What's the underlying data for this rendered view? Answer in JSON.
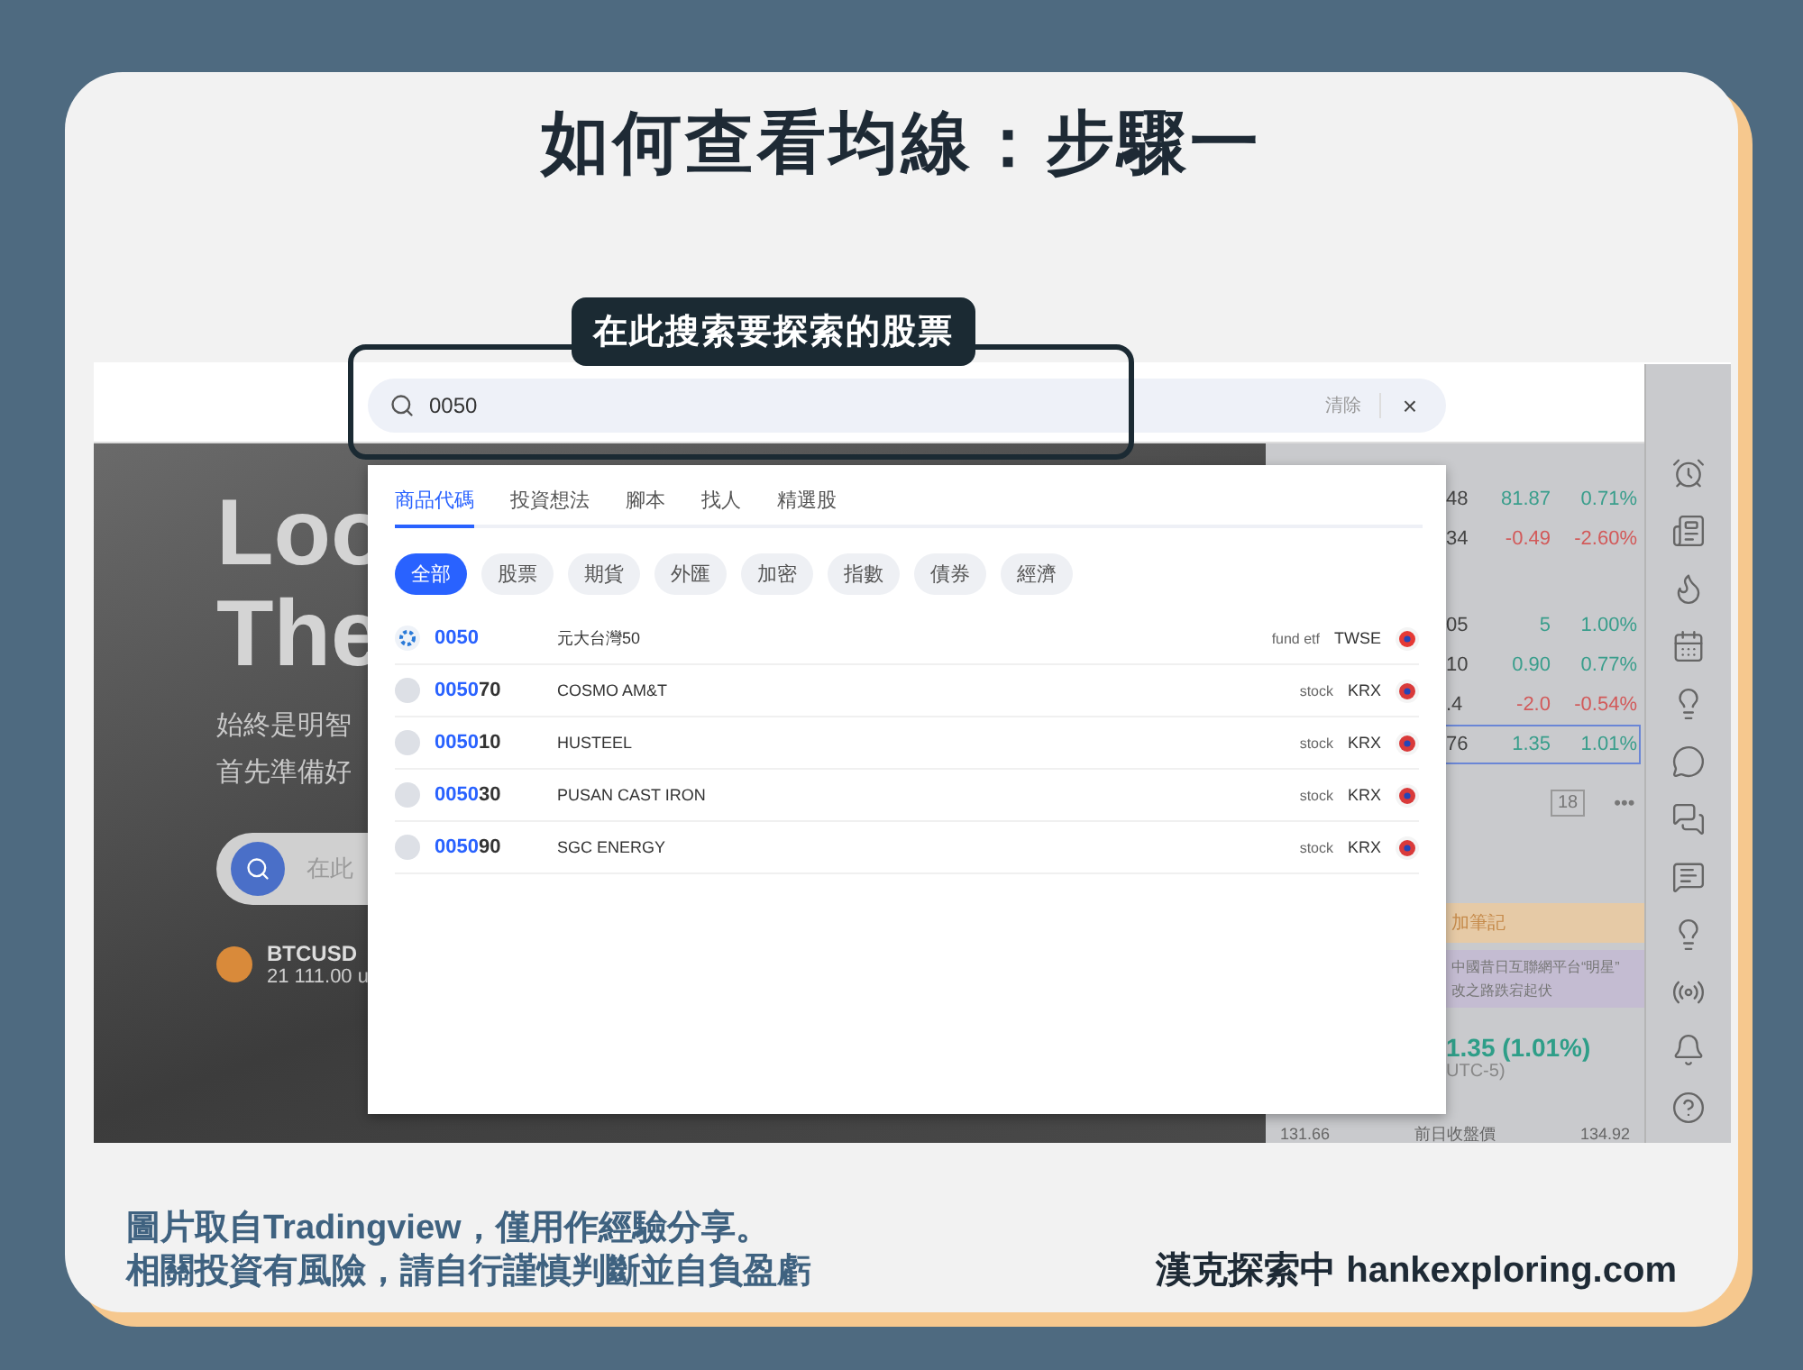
{
  "title": "如何查看均線：步驟一",
  "callout": "在此搜索要探索的股票",
  "search": {
    "value": "0050",
    "clear": "清除",
    "close": "×"
  },
  "tabs": [
    {
      "label": "商品代碼",
      "selected": true
    },
    {
      "label": "投資想法",
      "selected": false
    },
    {
      "label": "腳本",
      "selected": false
    },
    {
      "label": "找人",
      "selected": false
    },
    {
      "label": "精選股",
      "selected": false
    }
  ],
  "filters": [
    {
      "label": "全部",
      "selected": true
    },
    {
      "label": "股票",
      "selected": false
    },
    {
      "label": "期貨",
      "selected": false
    },
    {
      "label": "外匯",
      "selected": false
    },
    {
      "label": "加密",
      "selected": false
    },
    {
      "label": "指數",
      "selected": false
    },
    {
      "label": "債券",
      "selected": false
    },
    {
      "label": "經濟",
      "selected": false
    }
  ],
  "results": [
    {
      "kind": "logo",
      "symbol": "**0050**",
      "name": "元大台灣50",
      "type": "fund etf",
      "exchange": "TWSE",
      "color": "#e53935"
    },
    {
      "kind": "letter",
      "symbol": "**0050**70",
      "name": "COSMO AM&T",
      "type": "stock",
      "exchange": "KRX",
      "color": "#d93a3a"
    },
    {
      "kind": "letter",
      "symbol": "**0050**10",
      "name": "HUSTEEL",
      "type": "stock",
      "exchange": "KRX",
      "color": "#d93a3a"
    },
    {
      "kind": "letter",
      "symbol": "**0050**30",
      "name": "PUSAN CAST IRON",
      "type": "stock",
      "exchange": "KRX",
      "color": "#d93a3a"
    },
    {
      "kind": "letter",
      "symbol": "**0050**90",
      "name": "SGC ENERGY",
      "type": "stock",
      "exchange": "KRX",
      "color": "#d93a3a"
    }
  ],
  "hero": {
    "heading_lines": [
      "Loo",
      "The"
    ],
    "text_lines": [
      "始終是明智",
      "首先準備好"
    ],
    "search_placeholder": "在此",
    "ticker": {
      "symbol": "BTCUSD",
      "price": "21 111.00 u"
    }
  },
  "watchlist": [
    {
      "last": "48",
      "change": "81.87",
      "percent": "0.71%",
      "color": "#3a9e8c",
      "selected": false
    },
    {
      "last": "34",
      "change": "-0.49",
      "percent": "-2.60%",
      "color": "#d25a5a",
      "selected": false
    },
    {
      "last": "05",
      "change": "5",
      "percent": "1.00%",
      "color": "#3a9e8c",
      "selected": false
    },
    {
      "last": "10",
      "change": "0.90",
      "percent": "0.77%",
      "color": "#3a9e8c",
      "selected": false
    },
    {
      "last": ".4",
      "change": "-2.0",
      "percent": "-0.54%",
      "color": "#d25a5a",
      "selected": false
    },
    {
      "last": "76",
      "change": "1.35",
      "percent": "1.01%",
      "color": "#3a9e8c",
      "selected": true
    }
  ],
  "panel": {
    "count": "18",
    "more": "•••",
    "note": "加筆記",
    "news_lines": [
      "中國昔日互聯網平台“明星”",
      "改之路跌宕起伏"
    ],
    "quote": "1.35 (1.01%)",
    "timezone": "UTC-5)",
    "bottom_row": [
      "131.66",
      "前日收盤價",
      "134.92"
    ]
  },
  "footer": {
    "note_lines": [
      "圖片取自Tradingview，僅用作經驗分享。",
      "相關投資有風險，請自行謹慎判斷並自負盈虧"
    ],
    "credit": "漢克探索中 hankexploring.com"
  }
}
